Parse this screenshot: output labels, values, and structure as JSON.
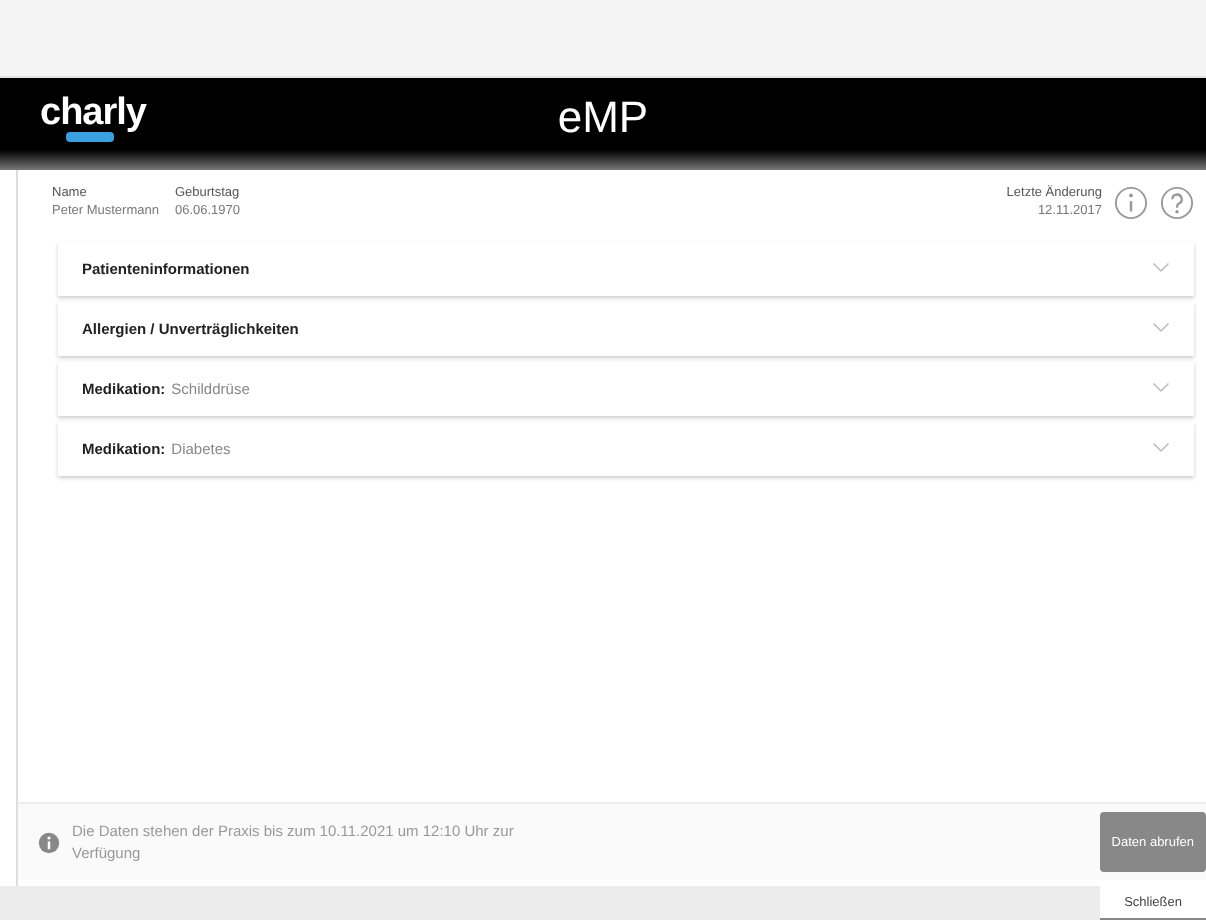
{
  "header": {
    "logo": "charly",
    "title": "eMP"
  },
  "patient": [
    {
      "label": "Name",
      "value": "Peter Mustermann"
    },
    {
      "label": "Geburtstag",
      "value": "06.06.1970"
    }
  ],
  "last_change": {
    "label": "Letzte Änderung",
    "value": "12.11.2017"
  },
  "sections": [
    {
      "title": "Patienteninformationen",
      "expanded": false
    },
    {
      "title": "Allergien / Unverträglichkeiten",
      "expanded": false
    },
    {
      "title": "Medikation:",
      "detail": "Schilddrüse",
      "expanded": false
    },
    {
      "title": "Medikation:",
      "detail": "Diabetes",
      "expanded": false
    }
  ],
  "footer": {
    "notice": "Die Daten stehen der Praxis bis zum 10.11.2021 um 12:10 Uhr zur Verfügung",
    "button": "Daten abrufen"
  },
  "close_button": "Schließen"
}
